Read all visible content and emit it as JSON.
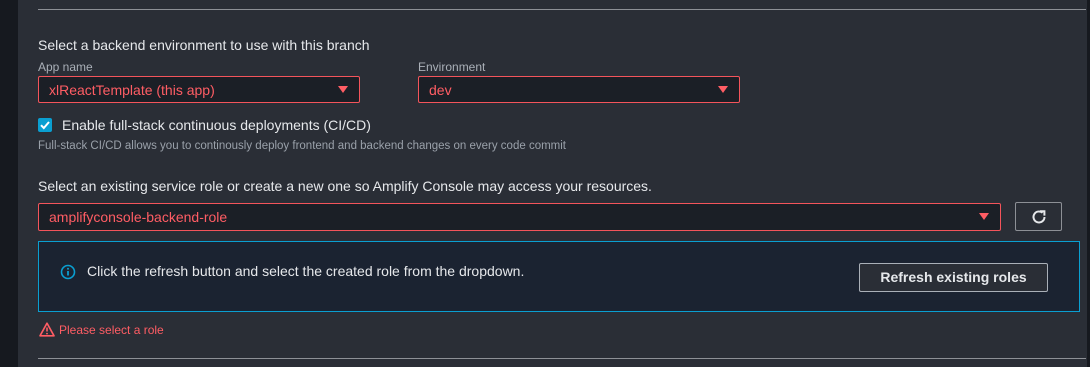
{
  "backend": {
    "section_label": "Select a backend environment to use with this branch",
    "app_name": {
      "label": "App name",
      "value": "xlReactTemplate (this app)"
    },
    "environment": {
      "label": "Environment",
      "value": "dev"
    }
  },
  "cicd": {
    "checked": true,
    "label": "Enable full-stack continuous deployments (CI/CD)",
    "help": "Full-stack CI/CD allows you to continously deploy frontend and backend changes on every code commit"
  },
  "service_role": {
    "label": "Select an existing service role or create a new one so Amplify Console may access your resources.",
    "value": "amplifyconsole-backend-role",
    "refresh_icon": "refresh-icon"
  },
  "info": {
    "icon": "info-icon",
    "text": "Click the refresh button and select the created role from the dropdown.",
    "button_label": "Refresh existing roles"
  },
  "error": {
    "icon": "warning-icon",
    "text": "Please select a role"
  },
  "colors": {
    "background": "#2a2e36",
    "error": "#ff5d64",
    "accent": "#0a9fd1"
  }
}
